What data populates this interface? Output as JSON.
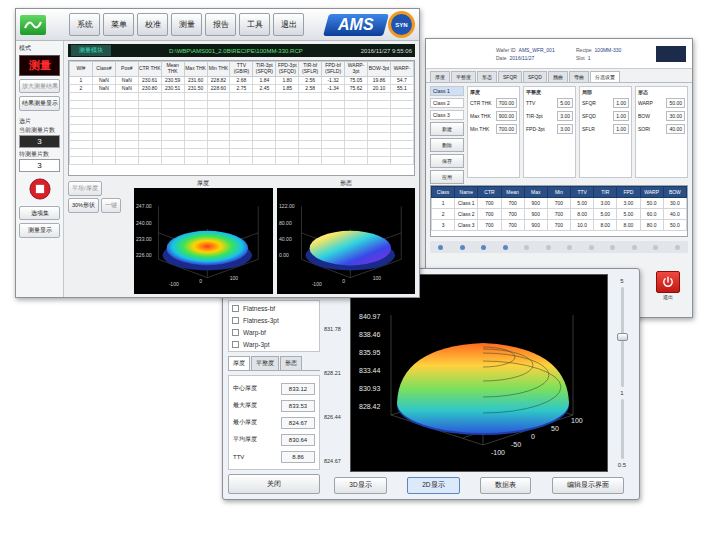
{
  "window_main": {
    "toolbar": [
      {
        "label": "系统"
      },
      {
        "label": "菜单"
      },
      {
        "label": "校准"
      },
      {
        "label": "测量"
      },
      {
        "label": "报告"
      },
      {
        "label": "工具"
      },
      {
        "label": "退出"
      }
    ],
    "brand": "AMS",
    "brand_badge": "SYN",
    "title": "测量模块",
    "recipe_path": "D:\\WBP\\AMS001_2.0B\\RECIPE\\100MM-330.RCP",
    "datetime": "2016/11/27 9:55:06",
    "sidebar": {
      "mode_label": "模式",
      "mode_value": "测量",
      "buttons": [
        {
          "label": "放大测量结果",
          "disabled": true
        },
        {
          "label": "结果测量显示",
          "disabled": false
        }
      ],
      "section_label": "选片",
      "counters": [
        {
          "label": "当前测量片数",
          "value": "3",
          "kind": "display"
        },
        {
          "label": "待测量片数",
          "value": "3",
          "kind": "field"
        }
      ],
      "footer_buttons": [
        "选项集",
        "测量显示"
      ]
    },
    "table": {
      "columns": [
        "Wf#",
        "Class#",
        "Pos#",
        "CTR THK",
        "Mean THK",
        "Max THK",
        "Min THK",
        "TTV (GBIR)",
        "TIR-3pt (SFQR)",
        "FPD-3pt (SFQD)",
        "TIR-bf (SFLR)",
        "FPD-bf (SFLD)",
        "WARP-3pt",
        "BOW-3pt",
        "WARP-"
      ],
      "rows": [
        [
          "1",
          "NaN",
          "NaN",
          "230.61",
          "230.59",
          "231.60",
          "228.82",
          "2.68",
          "1.84",
          "1.80",
          "2.56",
          "-1.32",
          "75.05",
          "19.86",
          "54.7"
        ],
        [
          "2",
          "NaN",
          "NaN",
          "230.80",
          "230.51",
          "231.50",
          "228.60",
          "2.75",
          "2.45",
          "1.85",
          "2.58",
          "-1.34",
          "75.62",
          "20.10",
          "55.1"
        ]
      ]
    },
    "actions": [
      {
        "label": "平坦/厚度",
        "disabled": true
      },
      {
        "label": "30%形状",
        "disabled": false
      },
      {
        "label": "一键",
        "disabled": true
      }
    ],
    "charts": [
      {
        "title": "厚度",
        "ticks": [
          "247.00",
          "240.00",
          "233.00",
          "226.00"
        ],
        "axis": [
          "-100",
          "0",
          "100"
        ],
        "kind": "thickness"
      },
      {
        "title": "形态",
        "ticks": [
          "122.00",
          "80.00",
          "40.00",
          "0.00"
        ],
        "axis": [
          "-100",
          "0",
          "100"
        ],
        "kind": "shape"
      }
    ]
  },
  "window_settings": {
    "header": [
      {
        "label": "Wafer ID",
        "value": "AMS_WFR_001"
      },
      {
        "label": "Recipe",
        "value": "100MM-330"
      },
      {
        "label": "Date",
        "value": "2016/11/27"
      },
      {
        "label": "Slot",
        "value": "1"
      }
    ],
    "tabs": [
      {
        "label": "厚度",
        "selected": false
      },
      {
        "label": "平整度",
        "selected": false
      },
      {
        "label": "形态",
        "selected": false
      },
      {
        "label": "SFQR",
        "selected": false
      },
      {
        "label": "SFQD",
        "selected": false
      },
      {
        "label": "翘曲",
        "selected": false
      },
      {
        "label": "弯曲",
        "selected": false
      },
      {
        "label": "分选设置",
        "selected": true
      }
    ],
    "list": [
      {
        "label": "Class 1",
        "selected": true
      },
      {
        "label": "Class 2",
        "selected": false
      },
      {
        "label": "Class 3",
        "selected": false
      }
    ],
    "side_buttons": [
      "新建",
      "删除",
      "保存",
      "应用"
    ],
    "groups": [
      {
        "title": "厚度",
        "fields": [
          {
            "label": "CTR THK",
            "value": "700.00"
          },
          {
            "label": "Max THK",
            "value": "900.00"
          },
          {
            "label": "Min THK",
            "value": "700.00"
          }
        ]
      },
      {
        "title": "平整度",
        "fields": [
          {
            "label": "TTV",
            "value": "5.00"
          },
          {
            "label": "TIR-3pt",
            "value": "3.00"
          },
          {
            "label": "FPD-3pt",
            "value": "3.00"
          }
        ]
      },
      {
        "title": "局部",
        "fields": [
          {
            "label": "SFQR",
            "value": "1.00"
          },
          {
            "label": "SFQD",
            "value": "1.00"
          },
          {
            "label": "SFLR",
            "value": "1.00"
          }
        ]
      },
      {
        "title": "形态",
        "fields": [
          {
            "label": "WARP",
            "value": "50.00"
          },
          {
            "label": "BOW",
            "value": "30.00"
          },
          {
            "label": "SORI",
            "value": "40.00"
          }
        ]
      }
    ],
    "table": {
      "columns": [
        "Class",
        "Name",
        "CTR",
        "Mean",
        "Max",
        "Min",
        "TTV",
        "TIR",
        "FPD",
        "WARP",
        "BOW"
      ],
      "rows": [
        [
          "1",
          "Class 1",
          "700",
          "700",
          "900",
          "700",
          "5.00",
          "3.00",
          "3.00",
          "50.0",
          "30.0"
        ],
        [
          "2",
          "Class 2",
          "700",
          "700",
          "900",
          "700",
          "8.00",
          "5.00",
          "5.00",
          "60.0",
          "40.0"
        ],
        [
          "3",
          "Class 3",
          "700",
          "700",
          "900",
          "700",
          "10.0",
          "8.00",
          "8.00",
          "80.0",
          "50.0"
        ]
      ]
    },
    "slider": {
      "level": 0.3
    },
    "exit_label": "退出"
  },
  "window_viewer": {
    "checks": [
      {
        "label": "Flatness-bf",
        "checked": false
      },
      {
        "label": "Flatness-3pt",
        "checked": false
      },
      {
        "label": "Warp-bf",
        "checked": false
      },
      {
        "label": "Warp-3pt",
        "checked": false
      }
    ],
    "tabs": [
      {
        "label": "厚度",
        "selected": true
      },
      {
        "label": "平整度",
        "selected": false
      },
      {
        "label": "形态",
        "selected": false
      }
    ],
    "fields": [
      {
        "label": "中心厚度",
        "value": "833.12"
      },
      {
        "label": "最大厚度",
        "value": "833.53"
      },
      {
        "label": "最小厚度",
        "value": "824.67"
      },
      {
        "label": "平均厚度",
        "value": "830.64"
      },
      {
        "label": "TTV",
        "value": "8.86"
      }
    ],
    "close_label": "关闭",
    "scale": [
      "831.78",
      "828.21",
      "826.44",
      "824.67"
    ],
    "chart": {
      "z_ticks": [
        "840.97",
        "838.46",
        "835.95",
        "833.44",
        "830.93",
        "828.42"
      ],
      "x_ticks": [
        "-100",
        "-50",
        "0",
        "50",
        "100"
      ]
    },
    "zoom": {
      "labels": [
        "5",
        "1",
        "0.5"
      ],
      "level": 0.5
    },
    "buttons": [
      {
        "label": "3D显示",
        "selected": false
      },
      {
        "label": "2D显示",
        "selected": true
      },
      {
        "label": "数据表",
        "selected": false
      },
      {
        "label": "编辑显示界面",
        "selected": false
      }
    ]
  }
}
